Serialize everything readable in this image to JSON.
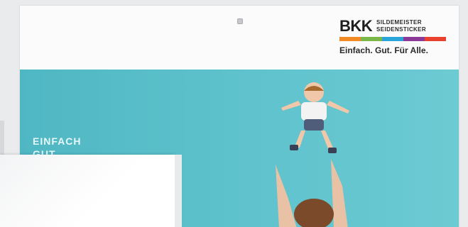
{
  "header": {
    "dot_icon": "small-square-icon"
  },
  "logo": {
    "brand": "BKK",
    "line1": "SILDEMEISTER",
    "line2": "SEIDENSTICKER",
    "tagline": "Einfach. Gut. Für Alle.",
    "stripe_colors": [
      "#f08a24",
      "#7ab648",
      "#2aa5d9",
      "#8c3a98",
      "#e8412e"
    ]
  },
  "hero": {
    "text_line1": "EINFACH",
    "text_line2": "GUT",
    "background": "#5dc1cb"
  }
}
